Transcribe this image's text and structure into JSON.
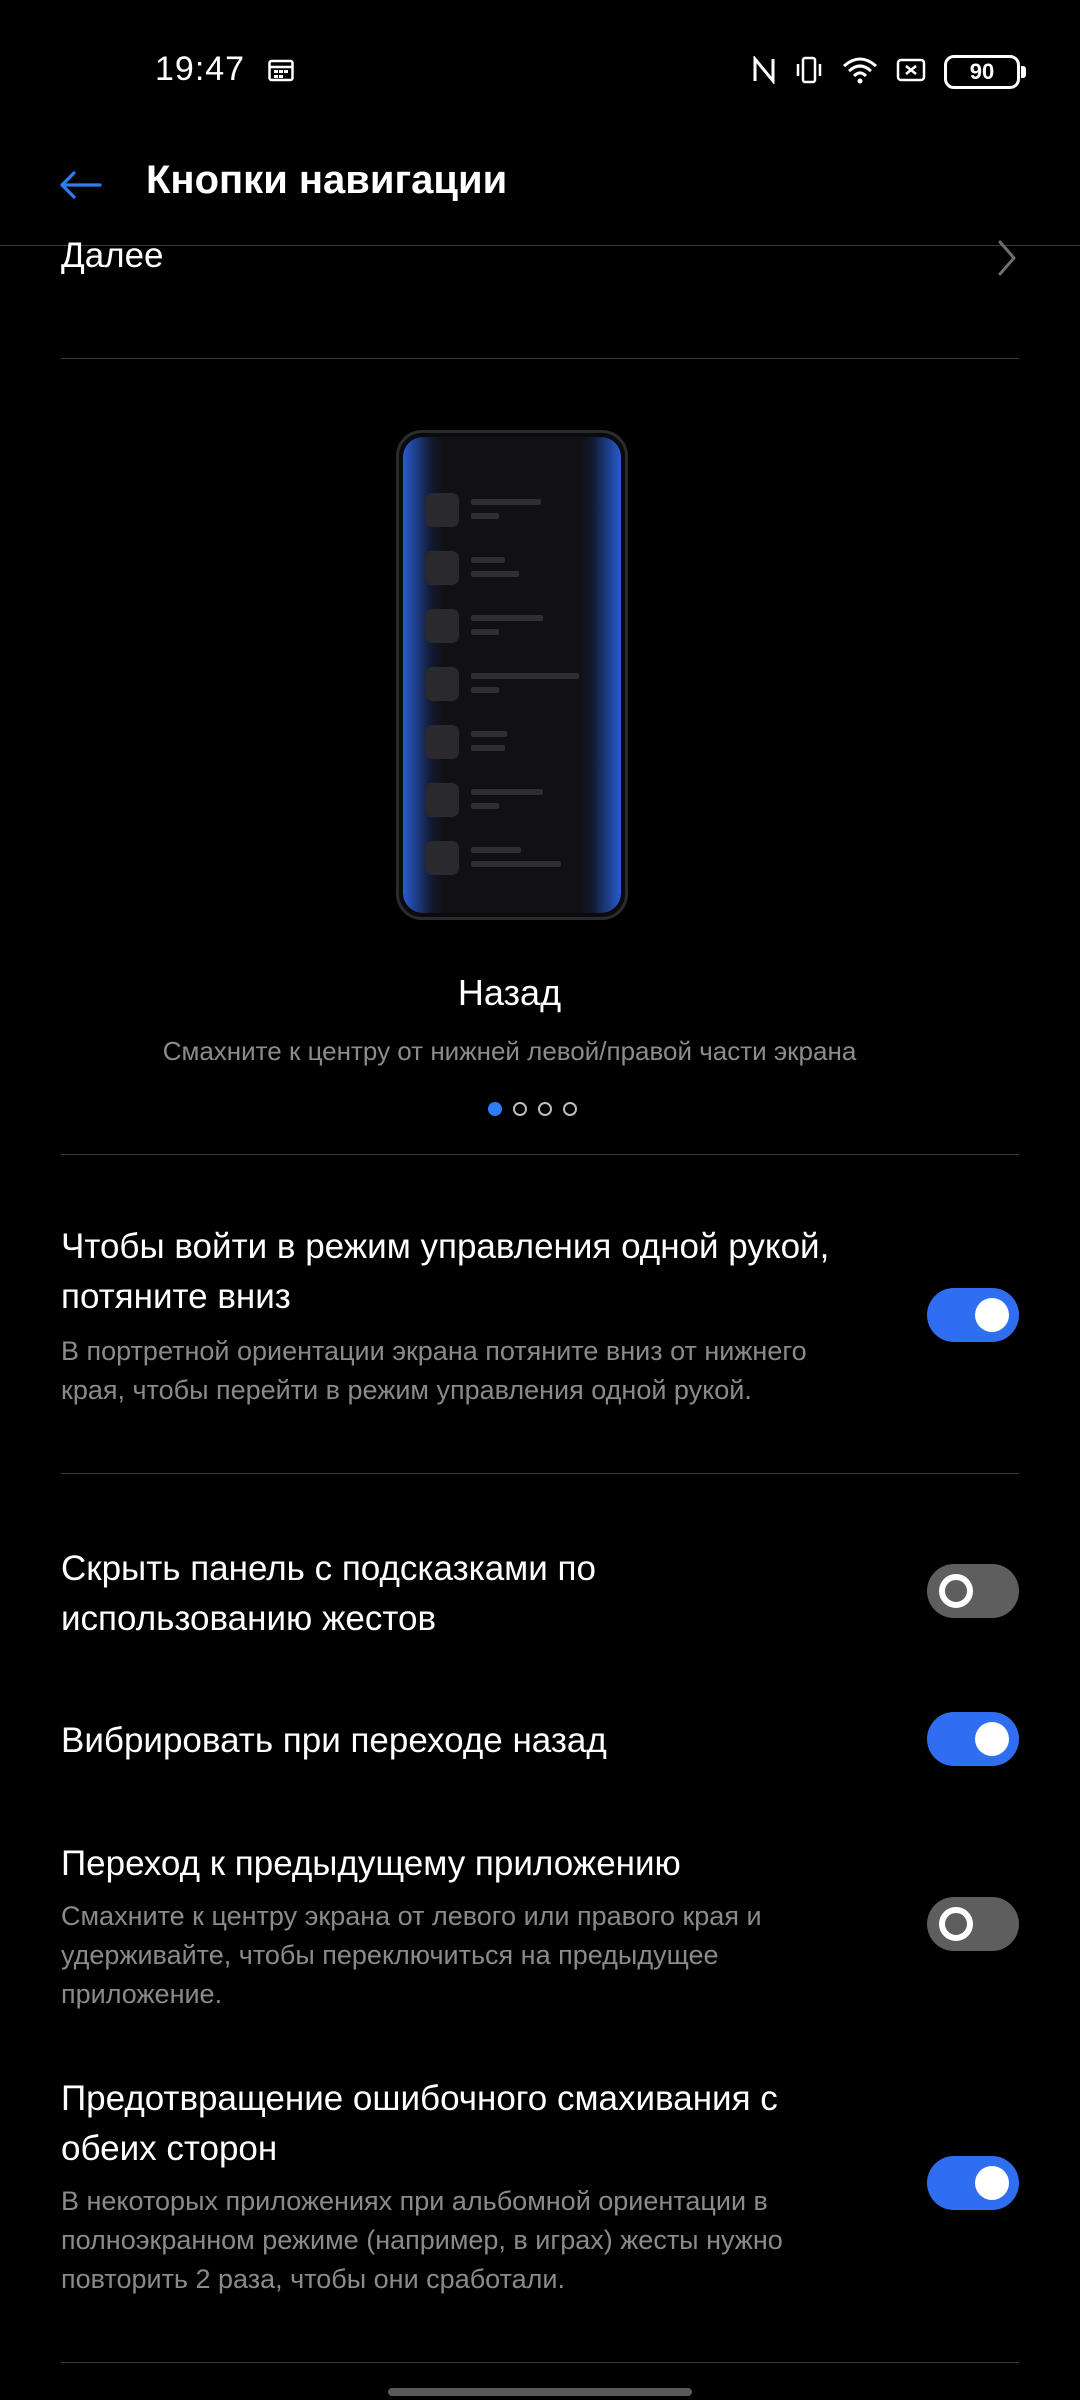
{
  "status_bar": {
    "time": "19:47",
    "battery": "90",
    "icons": [
      "calendar-icon",
      "nfc-icon",
      "vibrate-icon",
      "wifi-icon",
      "screen-record-icon",
      "battery-icon"
    ]
  },
  "header": {
    "title": "Кнопки навигации"
  },
  "next_row": {
    "label": "Далее"
  },
  "carousel": {
    "title": "Назад",
    "subtitle": "Смахните к центру от нижней левой/правой части экрана",
    "page_count": 4,
    "active_index": 0
  },
  "settings": [
    {
      "title": "Чтобы войти в режим управления одной рукой, потяните вниз",
      "description": "В портретной ориентации экрана потяните вниз от нижнего края, чтобы перейти в режим управления одной рукой.",
      "enabled": true
    },
    {
      "title": "Скрыть панель с подсказками по использованию жестов",
      "description": "",
      "enabled": false
    },
    {
      "title": "Вибрировать при переходе назад",
      "description": "",
      "enabled": true
    },
    {
      "title": "Переход к предыдущему приложению",
      "description": "Смахните к центру экрана от левого или правого края и удерживайте, чтобы переключиться на предыдущее приложение.",
      "enabled": false
    },
    {
      "title": "Предотвращение ошибочного смахивания с обеих сторон",
      "description": "В некоторых приложениях при альбомной ориентации в полноэкранном режиме (например, в играх) жесты нужно повторить 2 раза, чтобы они сработали.",
      "enabled": true
    }
  ],
  "colors": {
    "accent": "#2f6ef0",
    "background": "#000000",
    "secondary_text": "#8a8a8a"
  }
}
